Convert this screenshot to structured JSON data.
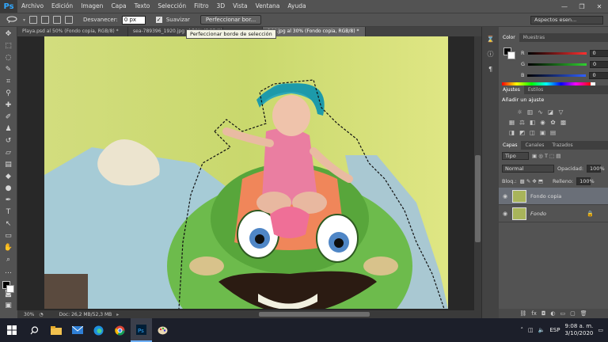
{
  "app": {
    "logo": "Ps"
  },
  "menu": [
    "Archivo",
    "Edición",
    "Imagen",
    "Capa",
    "Texto",
    "Selección",
    "Filtro",
    "3D",
    "Vista",
    "Ventana",
    "Ayuda"
  ],
  "window_controls": {
    "minimize": "—",
    "maximize": "❐",
    "close": "✕"
  },
  "options": {
    "feather_label": "Desvanecer:",
    "feather_value": "0 px",
    "antialias_label": "Suavizar",
    "antialias_checked": "✓",
    "refine_button": "Perfeccionar bor...",
    "workspace": "Aspectos esen..."
  },
  "tooltip": "Perfeccionar borde de selección",
  "doc_tabs": [
    {
      "label": "Playa.psd al 50% (Fondo copia, RGB/8) *"
    },
    {
      "label": "sea-789396_1920.jpg al 50% (RGB/8) *"
    },
    {
      "label": "…"
    },
    {
      "label": "144.jpg al 30% (Fondo copia, RGB/8) *"
    }
  ],
  "status": {
    "zoom": "30%",
    "doc_info": "Doc: 26,2 MB/52,3 MB"
  },
  "color_panel": {
    "tabs": [
      "Color",
      "Muestras"
    ],
    "rows": [
      {
        "label": "R",
        "value": "0",
        "color": "#ff3030"
      },
      {
        "label": "G",
        "value": "0",
        "color": "#30d030"
      },
      {
        "label": "B",
        "value": "0",
        "color": "#3060ff"
      }
    ]
  },
  "adjust_panel": {
    "tabs": [
      "Ajustes",
      "Estilos"
    ],
    "title": "Añadir un ajuste"
  },
  "layers_panel": {
    "tabs": [
      "Capas",
      "Canales",
      "Trazados"
    ],
    "filter": "Tipo",
    "blend_mode": "Normal",
    "opacity_label": "Opacidad:",
    "opacity_value": "100%",
    "lock_label": "Bloq.:",
    "fill_label": "Relleno:",
    "fill_value": "100%",
    "layers": [
      {
        "name": "Fondo copia",
        "selected": true
      },
      {
        "name": "Fondo",
        "locked": true
      }
    ]
  },
  "tray": {
    "language": "ESP",
    "time": "9:08 a. m.",
    "date": "3/10/2020"
  }
}
